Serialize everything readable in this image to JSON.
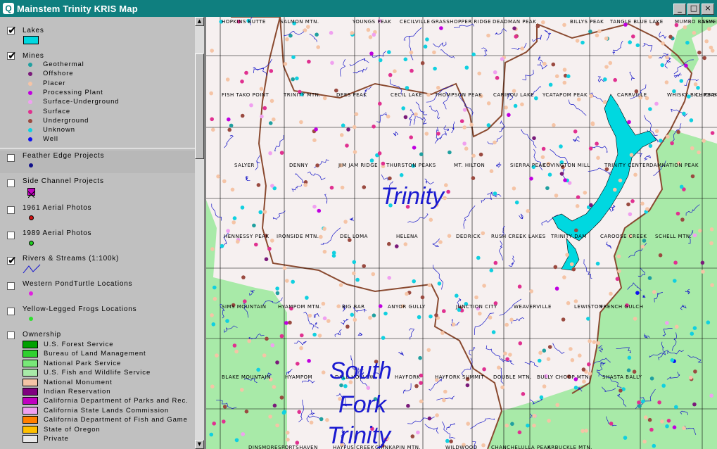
{
  "window": {
    "title": "Mainstem Trinity KRIS Map",
    "buttons": [
      "_",
      "□",
      "×"
    ]
  },
  "layers": {
    "lakes": {
      "label": "Lakes",
      "checked": true,
      "color": "#00d8e0"
    },
    "mines": {
      "label": "Mines",
      "checked": true,
      "items": [
        {
          "label": "Geothermal",
          "color": "#20a0a0"
        },
        {
          "label": "Offshore",
          "color": "#7a1a7a"
        },
        {
          "label": "Placer",
          "color": "#f5c4a6"
        },
        {
          "label": "Processing Plant",
          "color": "#c000e0"
        },
        {
          "label": "Surface-Underground",
          "color": "#f0a0f0"
        },
        {
          "label": "Surface",
          "color": "#e03090"
        },
        {
          "label": "Underground",
          "color": "#9a4a40"
        },
        {
          "label": "Unknown",
          "color": "#10d0e0"
        },
        {
          "label": "Well",
          "color": "#1010f0"
        }
      ]
    },
    "feather": {
      "label": "Feather Edge Projects",
      "checked": false
    },
    "sidechannel": {
      "label": "Side Channel Projects",
      "checked": false
    },
    "aerial1961": {
      "label": "1961 Aerial Photos",
      "checked": false
    },
    "aerial1989": {
      "label": "1989 Aerial Photos",
      "checked": false
    },
    "rivers": {
      "label": "Rivers & Streams (1:100k)",
      "checked": true
    },
    "turtle": {
      "label": "Western PondTurtle Locations",
      "checked": false
    },
    "frogs": {
      "label": "Yellow-Legged Frogs Locations",
      "checked": false
    },
    "ownership": {
      "label": "Ownership",
      "checked": false,
      "items": [
        {
          "label": "U.S. Forest Service",
          "color": "#00a000"
        },
        {
          "label": "Bureau of Land Management",
          "color": "#30d030"
        },
        {
          "label": "National Park Service",
          "color": "#78e878"
        },
        {
          "label": "U.S. Fish and Wildlife Service",
          "color": "#a8eaa8"
        },
        {
          "label": "National Monument",
          "color": "#f5c4a6"
        },
        {
          "label": "Indian Reservation",
          "color": "#800080"
        },
        {
          "label": "California Department of Parks and Rec.",
          "color": "#c000c0"
        },
        {
          "label": "California State Lands Commission",
          "color": "#f0a0f0"
        },
        {
          "label": "California Department of Fish and Game",
          "color": "#ff8000"
        },
        {
          "label": "State of Oregon",
          "color": "#ffc000"
        },
        {
          "label": "Private",
          "color": "#e8e8e8"
        }
      ]
    }
  },
  "map": {
    "region_labels": [
      "Trinity",
      "South",
      "Fork",
      "Trinity"
    ],
    "quads": [
      "HOPKINS BUTTE",
      "SALMON MTN.",
      "YOUNGS PEAK",
      "CECILVILLE",
      "GRASSHOPPER RIDGE",
      "DEADMAN PEAK",
      "BILLYS PEAK",
      "TANGLE BLUE LAKE",
      "MUMBO BASIN",
      "SEVEN",
      "FISH TAKO POINT",
      "TRINITY MTN.",
      "DEES PEAK",
      "CECIL LAKE",
      "THOMPSON PEAK",
      "CARIBOU LAKE",
      "YCATAPOM PEAK",
      "CARRVILLE",
      "WHISKY BILL PEAK",
      "CHICKE",
      "SALYER",
      "DENNY",
      "JIM JAM RIDGE",
      "THURSTON PEAKS",
      "MT. HILTON",
      "SIERRA PEAK",
      "COVINGTON MILL",
      "TRINITY CENTER",
      "DAMNATION PEAK",
      "HENNESSY PEAK",
      "IRONSIDE MTN.",
      "DEL LOMA",
      "HELENA",
      "DEDRICK",
      "RUSH CREEK LAKES",
      "TRINITY DAM",
      "CAROOSE CREEK",
      "SCHELL MTN.",
      "SIMS MOUNTAIN",
      "HYAMPOM MTN.",
      "BIG BAR",
      "ANYOR GULLY",
      "JUNCTION CITY",
      "WEAVERVILLE",
      "LEWISTON",
      "FRENCH GULCH",
      "BLAKE MOUNTAIN",
      "HYAMPOM",
      "DALE HOLLOW",
      "HAYFORK",
      "HAYFORK SUMMIT",
      "DOUBLE MTN.",
      "BULLY CHOOP MTN.",
      "SHASTA BALLY",
      "DINSMORE",
      "SPORTSHAVEN",
      "HAYFUS CREEK",
      "CHINKAPIN MTN.",
      "WILDWOOD",
      "CHANCHELULLA PEAK",
      "ARBUCKLE MTN."
    ]
  }
}
